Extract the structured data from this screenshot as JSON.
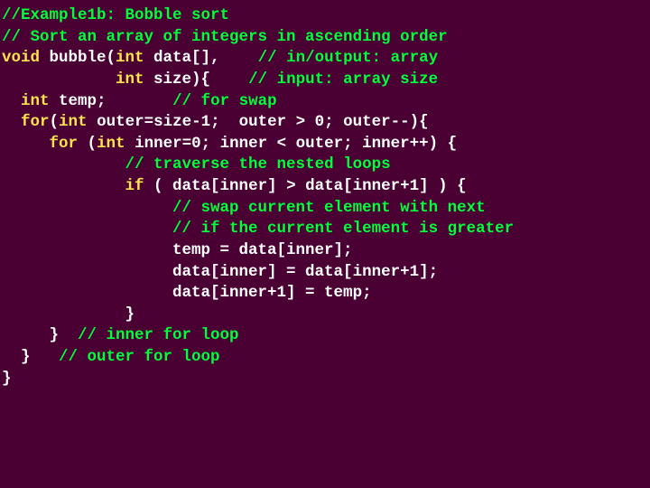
{
  "code": {
    "l01_c": "//Example1b: Bobble sort",
    "l02_c": "// Sort an array of integers in ascending order",
    "l03_k1": "void ",
    "l03_i1": "bubble(",
    "l03_k2": "int ",
    "l03_i2": "data[],    ",
    "l03_c": "// in/output: array",
    "l04_pad": "            ",
    "l04_k1": "int ",
    "l04_i1": "size){    ",
    "l04_c": "// input: array size",
    "l05_pad": "  ",
    "l05_k1": "int ",
    "l05_i1": "temp;       ",
    "l05_c": "// for swap",
    "l06_pad": "  ",
    "l06_k1": "for",
    "l06_i1": "(",
    "l06_k2": "int ",
    "l06_i2": "outer=size-1;  outer > 0; outer--){",
    "l07_pad": "     ",
    "l07_k1": "for ",
    "l07_i1": "(",
    "l07_k2": "int ",
    "l07_i2": "inner=0; inner < outer; inner++) {",
    "l08_pad": "             ",
    "l08_c": "// traverse the nested loops",
    "l09_pad": "             ",
    "l09_k1": "if ",
    "l09_i1": "( data[inner] > data[inner+1] ) {",
    "l10_pad": "                  ",
    "l10_c": "// swap current element with next",
    "l11_pad": "                  ",
    "l11_c": "// if the current element is greater",
    "l12_pad": "                  ",
    "l12_i": "temp = data[inner];",
    "l13_pad": "                  ",
    "l13_i": "data[inner] = data[inner+1];",
    "l14_pad": "                  ",
    "l14_i": "data[inner+1] = temp;",
    "l15_pad": "             ",
    "l15_i": "}",
    "l16_pad": "     ",
    "l16_i": "}  ",
    "l16_c": "// inner for loop",
    "l17_pad": "  ",
    "l17_i": "}   ",
    "l17_c": "// outer for loop",
    "l18_i": "}"
  }
}
